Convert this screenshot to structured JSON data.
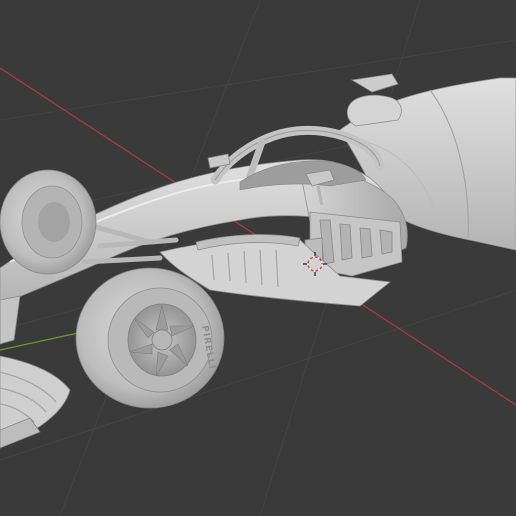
{
  "viewport": {
    "background": "#3a3a3a",
    "grid_line_color": "#444444",
    "x_axis_color": "#b0393f",
    "y_axis_color": "#6c9a2d"
  },
  "model": {
    "material_color": "#cfcfcf",
    "shade_color": "#a9a9a9",
    "dark_shade_color": "#8a8a8a",
    "tire_brand_text": "PIRELLI"
  },
  "icons": {
    "origin": "3d-cursor-icon"
  }
}
